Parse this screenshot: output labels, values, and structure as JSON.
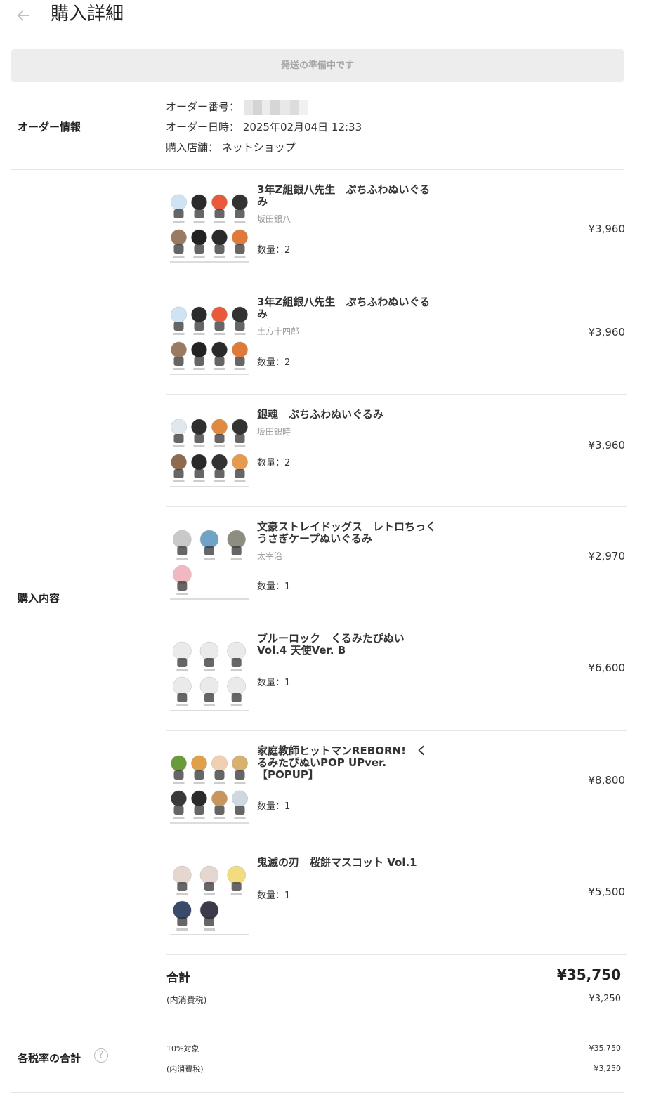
{
  "header": {
    "back_icon": "arrow-left-icon",
    "title": "購入詳細"
  },
  "status": {
    "label": "発送の準備中です"
  },
  "order_info": {
    "section_label": "オーダー情報",
    "order_number_label": "オーダー番号：",
    "order_date_label": "オーダー日時：",
    "order_date": "2025年02月04日 12:33",
    "store_label": "購入店舗：",
    "store": "ネットショップ"
  },
  "purchase": {
    "section_label": "購入内容",
    "items": [
      {
        "name": "3年Z組銀八先生　ぷちふわぬいぐるみ",
        "variant": "坂田銀八",
        "quantity": "数量：2",
        "price": "¥3,960"
      },
      {
        "name": "3年Z組銀八先生　ぷちふわぬいぐるみ",
        "variant": "土方十四郎",
        "quantity": "数量：2",
        "price": "¥3,960"
      },
      {
        "name": "銀魂　ぷちふわぬいぐるみ",
        "variant": "坂田銀時",
        "quantity": "数量：2",
        "price": "¥3,960"
      },
      {
        "name": "文豪ストレイドッグス　レトロちっく うさぎケープぬいぐるみ",
        "variant": "太宰治",
        "quantity": "数量：1",
        "price": "¥2,970"
      },
      {
        "name": "ブルーロック　くるみたぴぬい Vol.4 天使Ver. B",
        "variant": "",
        "quantity": "数量：1",
        "price": "¥6,600"
      },
      {
        "name": "家庭教師ヒットマンREBORN!　くるみたぴぬいPOP UPver.【POPUP】",
        "variant": "",
        "quantity": "数量：1",
        "price": "¥8,800"
      },
      {
        "name": "鬼滅の刃　桜餅マスコット Vol.1",
        "variant": "",
        "quantity": "数量：1",
        "price": "¥5,500"
      }
    ],
    "total_label": "合計",
    "total": "¥35,750",
    "tax_label": "(内消費税)",
    "tax": "¥3,250"
  },
  "tax_rates": {
    "section_label": "各税率の合計",
    "help_icon": "question-circle-icon",
    "help_glyph": "?",
    "rate_label": "10%対象",
    "rate_total": "¥35,750",
    "tax_label": "(内消費税)",
    "tax": "¥3,250"
  }
}
